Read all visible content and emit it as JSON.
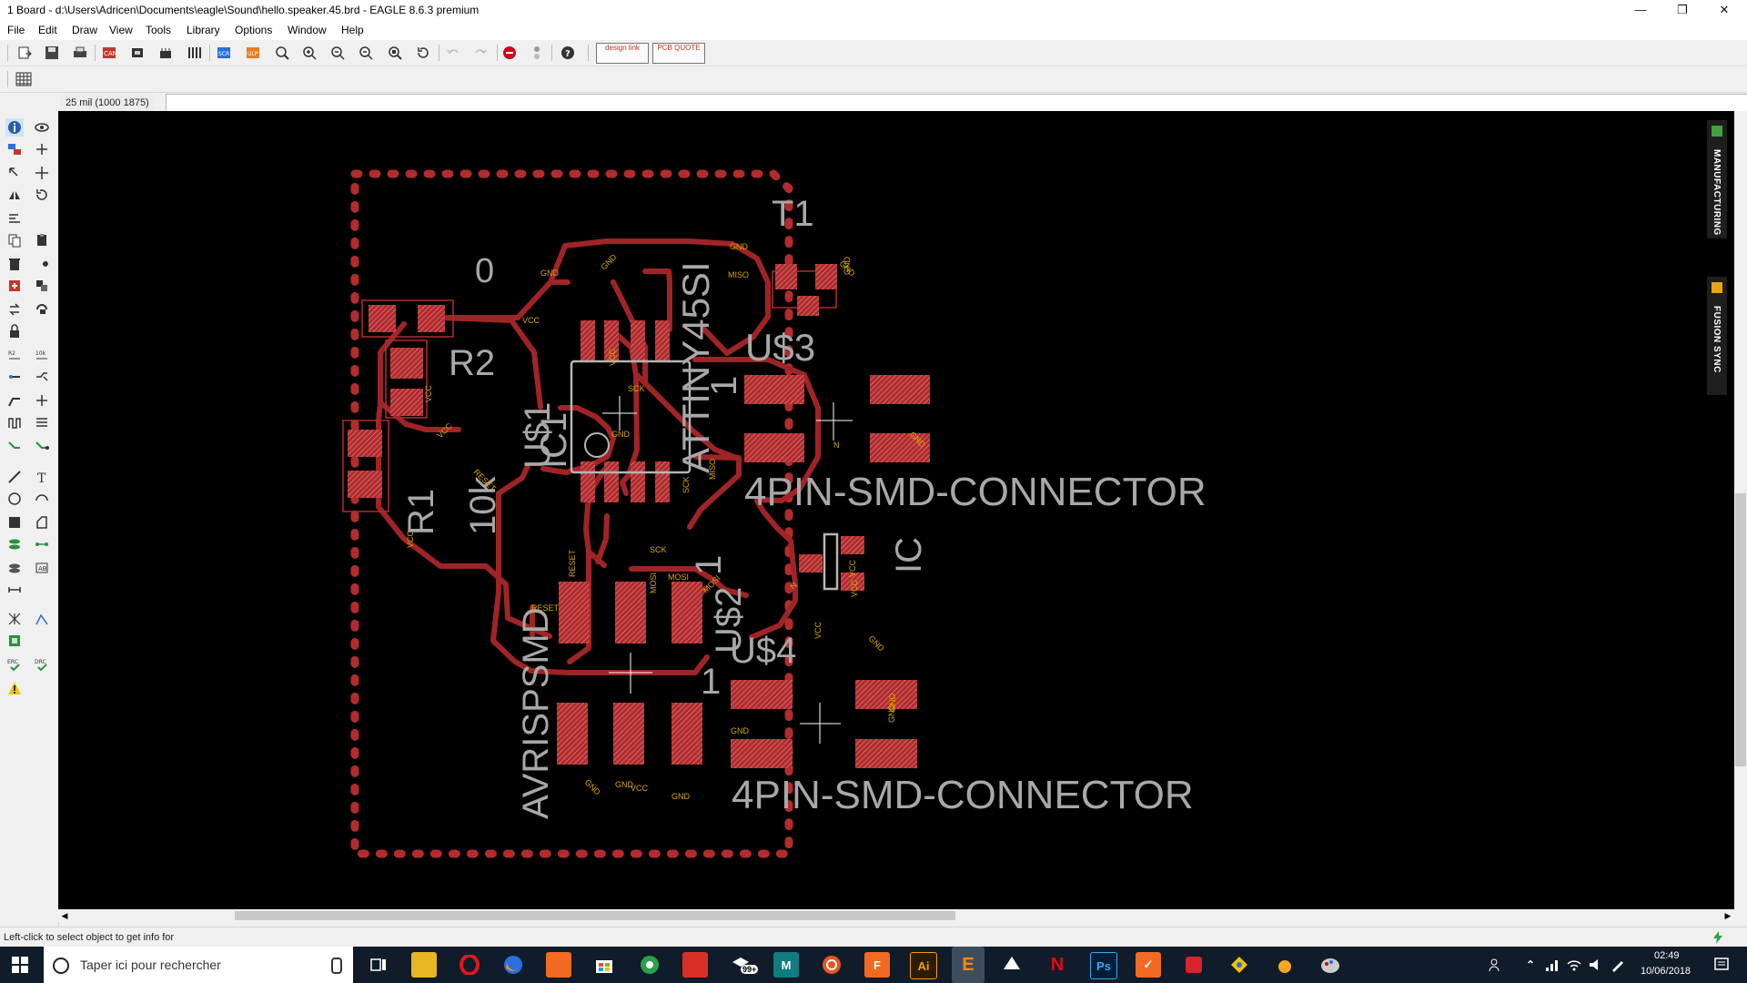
{
  "window": {
    "title": "1 Board - d:\\Users\\Adricen\\Documents\\eagle\\Sound\\hello.speaker.45.brd - EAGLE 8.6.3 premium",
    "controls": [
      "minimize-icon",
      "restore-icon",
      "close-icon"
    ]
  },
  "menu": [
    "File",
    "Edit",
    "Draw",
    "View",
    "Tools",
    "Library",
    "Options",
    "Window",
    "Help"
  ],
  "toolbar": {
    "buttons": [
      "open-icon",
      "save-icon",
      "print-icon",
      "cam-icon",
      "board-icon",
      "schematic-icon",
      "library-icon",
      "script-icon",
      "ulp-icon",
      "zoom-fit-icon",
      "zoom-in-icon",
      "zoom-out-icon",
      "zoom-select-icon",
      "zoom-area-icon",
      "redraw-icon",
      "undo-icon",
      "redo-icon",
      "stop-icon",
      "go-icon",
      "help-icon"
    ],
    "design_link": "design link",
    "pcb_quote": "PCB QUOTE"
  },
  "command": {
    "coord": "25 mil (1000 1875)",
    "input_value": ""
  },
  "board": {
    "labels": {
      "t1": "T1",
      "zero": "0",
      "r2": "R2",
      "ic1": "IC1",
      "us1": "U$1",
      "attiny": "ATTINY45SI",
      "us3": "U$3",
      "one_a": "1",
      "connector1": "4PIN-SMD-CONNECTOR",
      "r1": "R1",
      "tenk": "10k",
      "ic": "IC",
      "one_b": "1",
      "us2": "U$2",
      "us4": "U$4",
      "one_c": "1",
      "avrisp": "AVRISPSMD",
      "connector2": "4PIN-SMD-CONNECTOR"
    },
    "net_labels": [
      "GND",
      "GND",
      "GND",
      "MISO",
      "VCC",
      "VCC",
      "VCC",
      "SCK",
      "SCK",
      "GND",
      "MOSI",
      "RESET",
      "RESET",
      "MISO",
      "N",
      "N",
      "VCC",
      "VCC",
      "GND",
      "GND",
      "GND",
      "VCC",
      "VCC",
      "GND",
      "GND",
      "SCK",
      "MOSI",
      "MOSI",
      "RESET",
      "VCC",
      "GND",
      "GND",
      "VCC",
      "GND",
      "GND",
      "GND"
    ]
  },
  "right_tabs": {
    "manufacturing": "MANUFACTURING",
    "fusion": "FUSION SYNC"
  },
  "status": {
    "text": "Left-click to select object to get info for"
  },
  "taskbar": {
    "search_placeholder": "Taper ici pour rechercher",
    "badge": "99+",
    "time": "02:49",
    "date": "10/06/2018",
    "apps": [
      "task-view-icon",
      "explorer-icon",
      "opera-icon",
      "firefox-icon",
      "app-icon",
      "store-icon",
      "chrome-icon",
      "gift-icon",
      "mail-icon",
      "maya-icon",
      "ubuntu-icon",
      "fiverr-icon",
      "illustrator-icon",
      "eagle-icon",
      "inkscape-icon",
      "netflix-icon",
      "photoshop-icon",
      "todoist-icon",
      "acrobat-icon",
      "blender-icon",
      "sketch-icon",
      "paint-icon"
    ]
  },
  "colors": {
    "board_bg": "#000000",
    "copper": "#a02426",
    "pad": "#b32b2d",
    "label": "#a8a8a8",
    "net": "#d9a600"
  }
}
